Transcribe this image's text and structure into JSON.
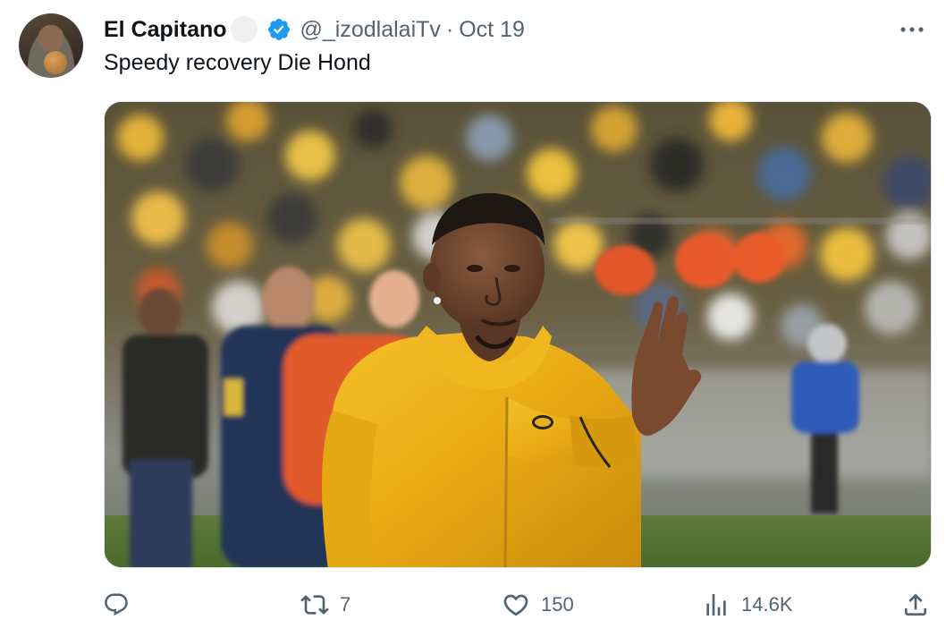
{
  "tweet": {
    "author": {
      "display_name": "El Capitano",
      "handle": "@_izodlalaiTv",
      "separator": "·",
      "timestamp": "Oct 19",
      "verified_icon": "verified-badge-icon",
      "verified_color": "#1d9bf0"
    },
    "text": "Speedy recovery Die Hond",
    "media": {
      "type": "photo",
      "alt": "Footballer in yellow jacket raising hand in a stadium"
    },
    "actions": {
      "reply": {
        "icon": "reply-icon",
        "count": ""
      },
      "retweet": {
        "icon": "retweet-icon",
        "count": "7"
      },
      "like": {
        "icon": "heart-icon",
        "count": "150"
      },
      "views": {
        "icon": "views-chart-icon",
        "count": "14.6K"
      },
      "share": {
        "icon": "share-icon"
      }
    },
    "more_icon": "more-options-icon"
  },
  "colors": {
    "text_primary": "#0f1419",
    "text_secondary": "#536471",
    "accent": "#1d9bf0"
  }
}
